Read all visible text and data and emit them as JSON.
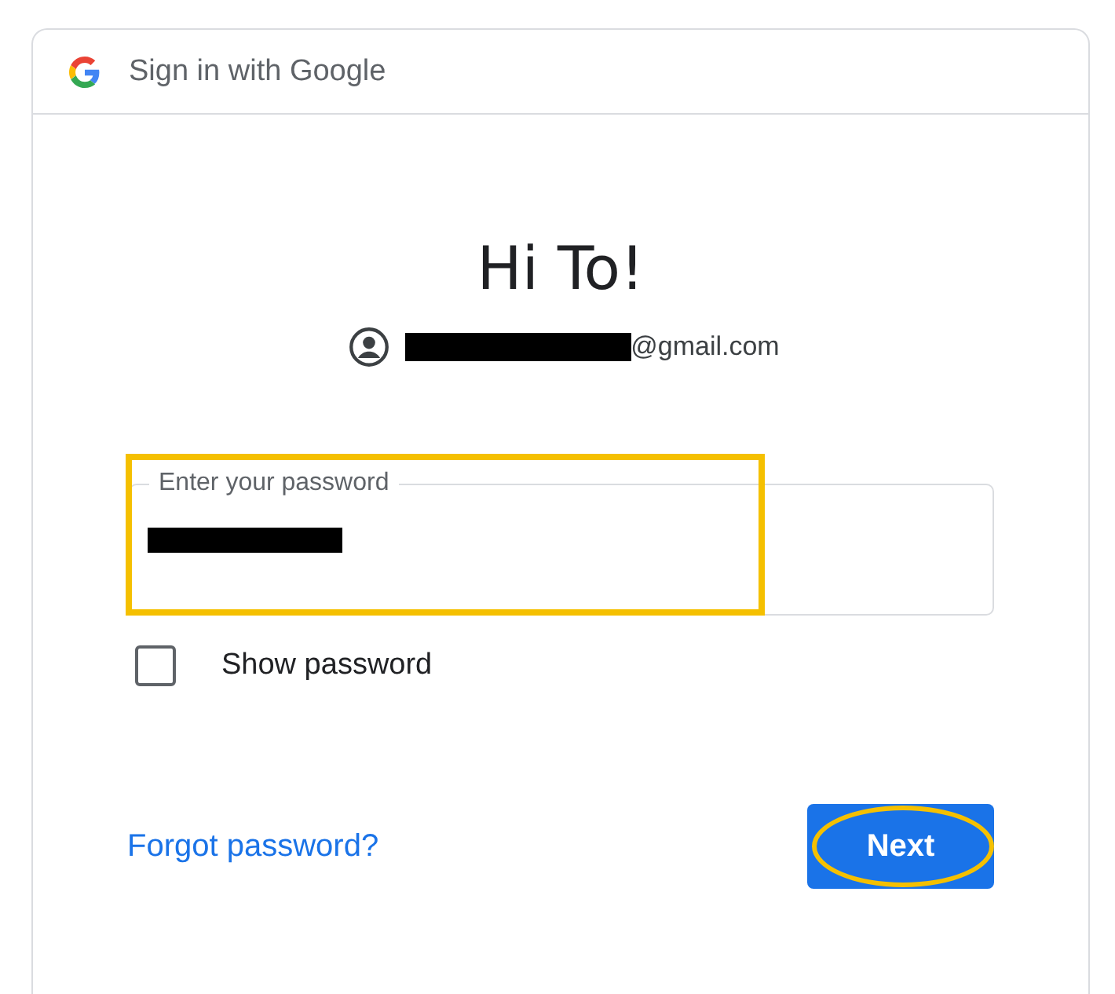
{
  "header": {
    "title": "Sign in with Google"
  },
  "greeting": "Hi To!",
  "account": {
    "email_suffix": "@gmail.com",
    "redacted": true
  },
  "password_field": {
    "label": "Enter your password",
    "redacted": true,
    "highlighted": true
  },
  "show_password": {
    "label": "Show password",
    "checked": false
  },
  "forgot_link": "Forgot password?",
  "next_button": {
    "label": "Next",
    "highlighted": true
  }
}
